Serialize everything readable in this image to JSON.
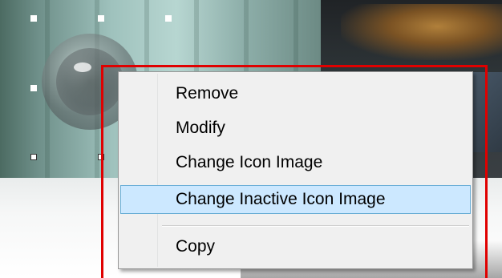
{
  "context_menu": {
    "items": [
      {
        "label": "Remove",
        "selected": false
      },
      {
        "label": "Modify",
        "selected": false
      },
      {
        "label": "Change Icon Image",
        "selected": false
      },
      {
        "label": "Change Inactive Icon Image",
        "selected": true
      },
      {
        "label": "Copy",
        "selected": false
      }
    ],
    "selected_color": "#cce8ff",
    "selected_border_color": "#6aaed6"
  },
  "highlight": {
    "color": "#e00000"
  }
}
